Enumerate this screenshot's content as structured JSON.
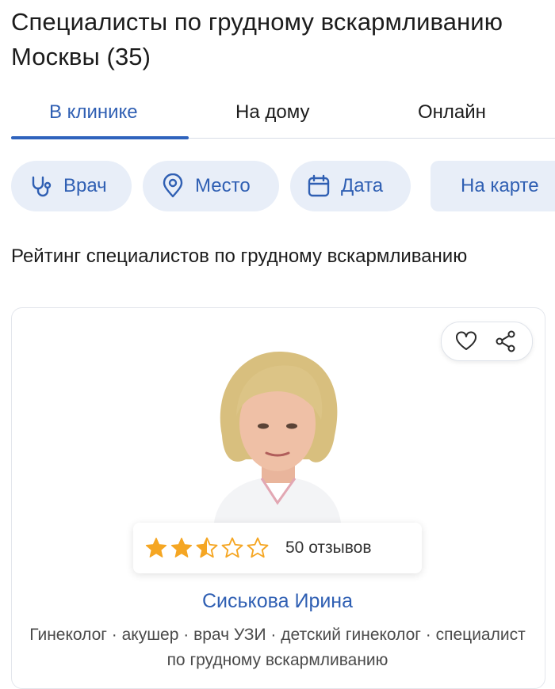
{
  "header": {
    "title": "Специалисты по грудному вскармливанию Москвы (35)"
  },
  "tabs": [
    {
      "label": "В клинике",
      "active": true
    },
    {
      "label": "На дому",
      "active": false
    },
    {
      "label": "Онлайн",
      "active": false
    }
  ],
  "filters": {
    "doctor": "Врач",
    "place": "Место",
    "date": "Дата",
    "map": "На карте"
  },
  "section": {
    "title": "Рейтинг специалистов по грудному вскармливанию"
  },
  "doctor_card": {
    "name": "Сиськова Ирина",
    "specialties": "Гинеколог · акушер · врач УЗИ · детский гинеколог · специалист по грудному вскармливанию",
    "rating": 2.5,
    "rating_max": 5,
    "reviews": "50 отзывов"
  },
  "colors": {
    "accent": "#2f5fb3",
    "chip_bg": "#e8eef8",
    "star": "#f5a623"
  },
  "icons": {
    "doctor": "stethoscope-icon",
    "place": "map-pin-icon",
    "date": "calendar-icon",
    "favorite": "heart-icon",
    "share": "share-icon"
  }
}
